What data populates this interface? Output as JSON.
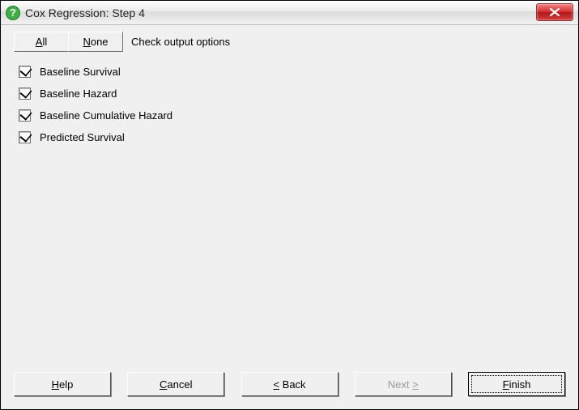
{
  "title": "Cox Regression: Step 4",
  "toolbar": {
    "all_label": "All",
    "none_label": "None",
    "prompt": "Check output options"
  },
  "options": [
    {
      "label": "Baseline Survival",
      "checked": true
    },
    {
      "label": "Baseline Hazard",
      "checked": true
    },
    {
      "label": "Baseline Cumulative Hazard",
      "checked": true
    },
    {
      "label": "Predicted Survival",
      "checked": true
    }
  ],
  "buttons": {
    "help": "Help",
    "cancel": "Cancel",
    "back": "< Back",
    "next": "Next >",
    "finish": "Finish"
  },
  "state": {
    "next_enabled": false
  }
}
